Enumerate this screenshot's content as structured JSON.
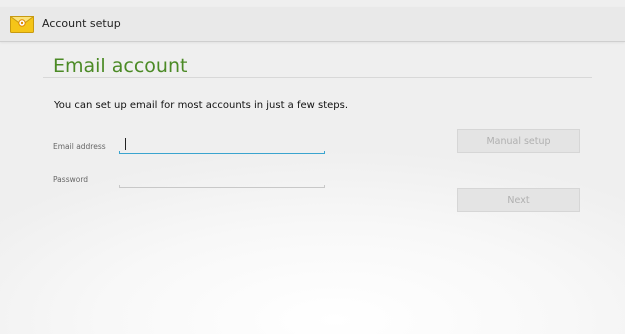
{
  "actionbar": {
    "title": "Account setup",
    "icon": "email-envelope-icon"
  },
  "main": {
    "heading": "Email account",
    "intro": "You can set up email for most accounts in just a few steps.",
    "email_label": "Email address",
    "email_value": "",
    "password_label": "Password",
    "password_value": ""
  },
  "buttons": {
    "manual_setup": "Manual setup",
    "next": "Next"
  },
  "colors": {
    "heading_green": "#4b8a25",
    "focus_blue": "#3aa4cf",
    "icon_yellow": "#f5c518"
  }
}
